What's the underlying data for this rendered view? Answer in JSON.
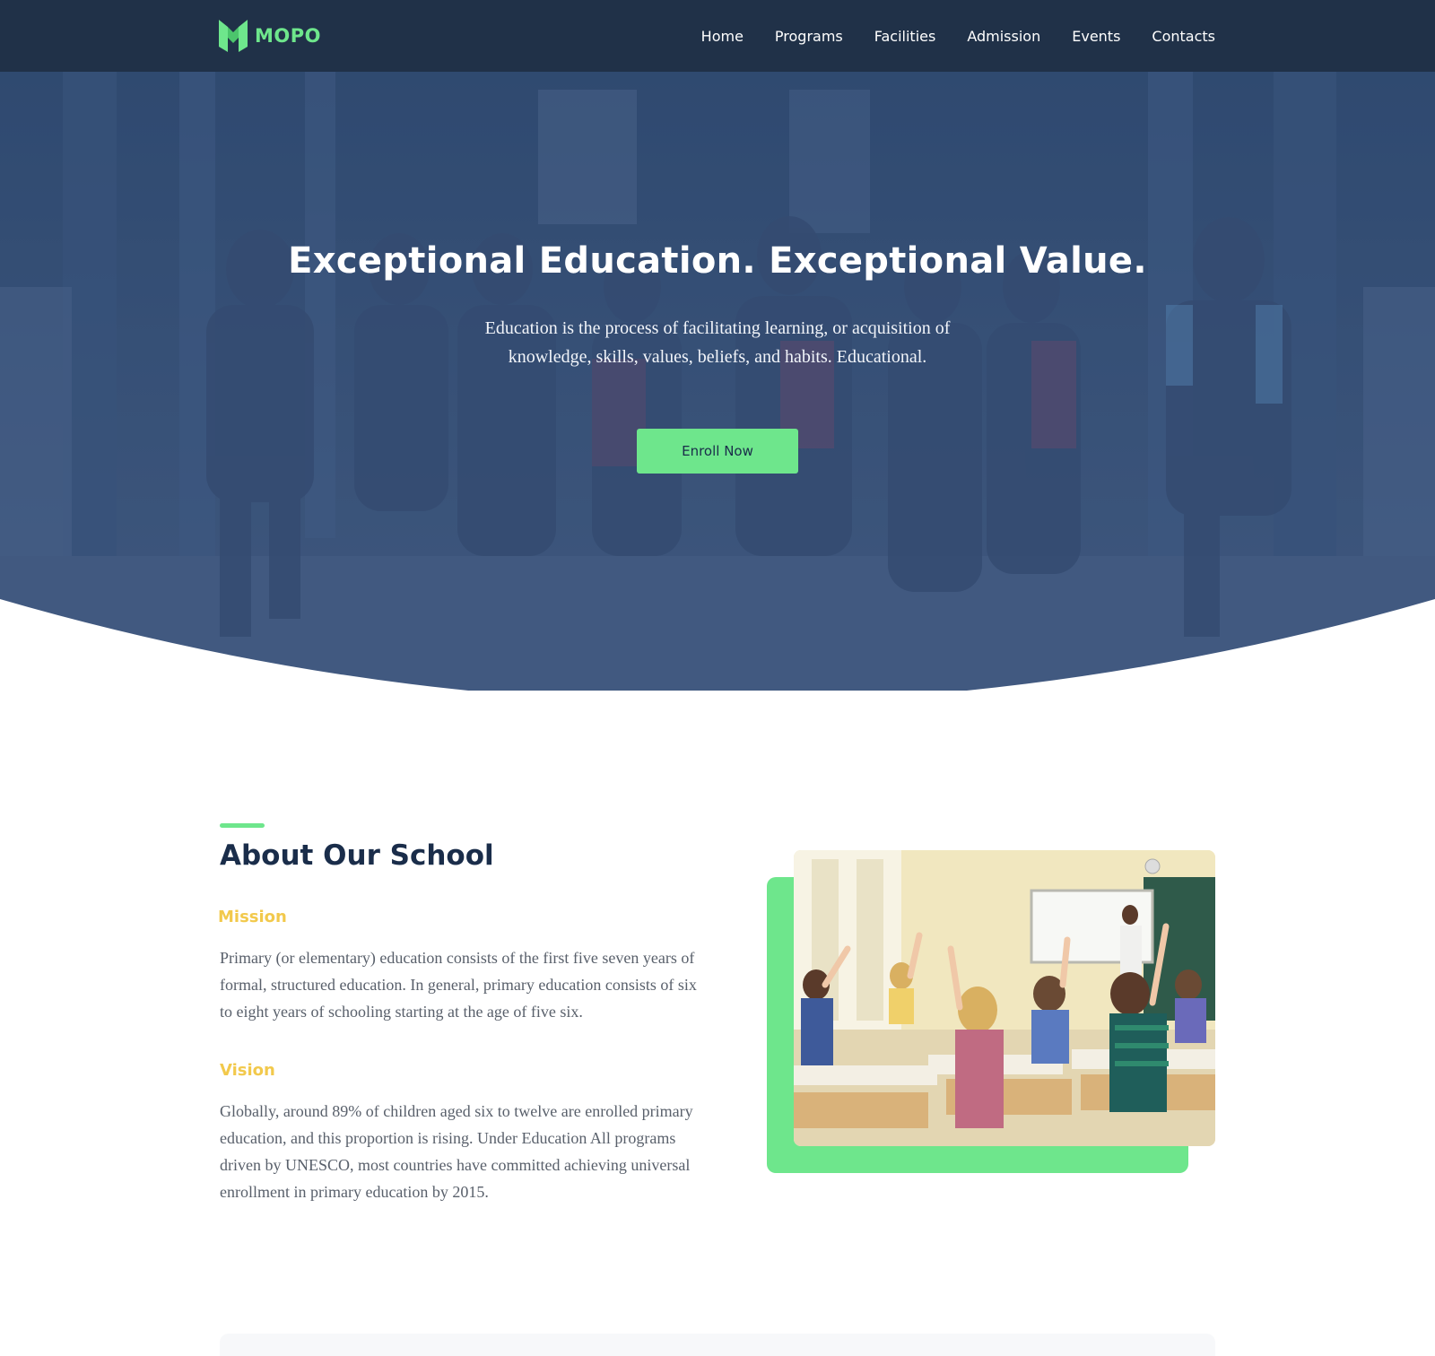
{
  "brand": {
    "name": "MOPO"
  },
  "nav": {
    "items": [
      {
        "label": "Home"
      },
      {
        "label": "Programs"
      },
      {
        "label": "Facilities"
      },
      {
        "label": "Admission"
      },
      {
        "label": "Events"
      },
      {
        "label": "Contacts"
      }
    ]
  },
  "hero": {
    "title": "Exceptional Education. Exceptional Value.",
    "subtitle": "Education is the process of facilitating learning, or acquisition of knowledge, skills, values, beliefs, and habits. Educational.",
    "cta_label": "Enroll Now"
  },
  "about": {
    "title": "About Our School",
    "mission": {
      "label": "Mission",
      "text": "Primary (or elementary) education consists of the first five seven years of formal, structured education. In general, primary education consists of six to eight years of schooling starting at the age of five six."
    },
    "vision": {
      "label": "Vision",
      "text": "Globally, around 89% of children aged six to twelve are enrolled primary education, and this proportion is rising. Under Education All programs driven by UNESCO, most countries have committed achieving universal enrollment in primary education by 2015."
    }
  },
  "colors": {
    "accent_green": "#6ee68c",
    "navy": "#1a2d4a",
    "label_yellow": "#f2c94c",
    "body_text": "#59606b"
  }
}
